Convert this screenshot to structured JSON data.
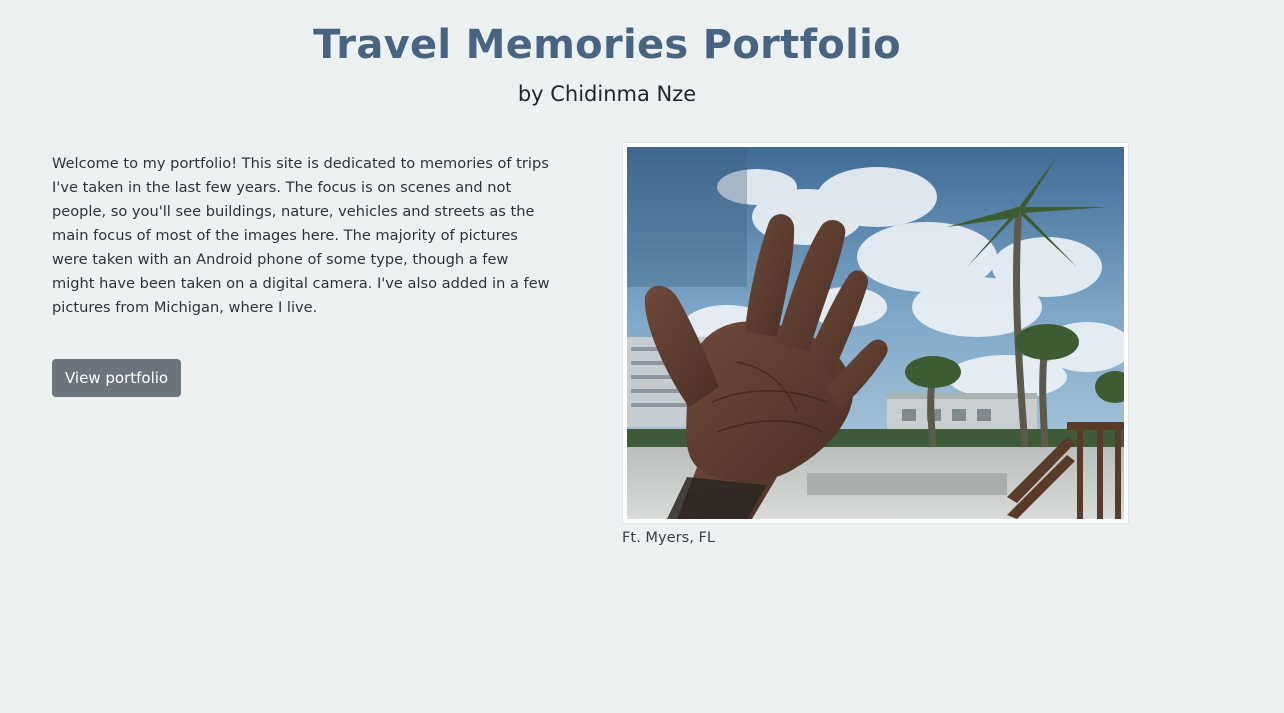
{
  "header": {
    "title": "Travel Memories Portfolio",
    "subtitle": "by Chidinma Nze"
  },
  "intro": {
    "text": "Welcome to my portfolio! This site is dedicated to memories of trips I've taken in the last few years. The focus is on scenes and not people, so you'll see buildings, nature, vehicles and streets as the main focus of most of the images here. The majority of pictures were taken with an Android phone of some type, though a few might have been taken on a digital camera. I've also added in a few pictures from Michigan, where I live."
  },
  "actions": {
    "view_portfolio_label": "View portfolio"
  },
  "featured_photo": {
    "caption": "Ft. Myers, FL"
  },
  "colors": {
    "background": "#ecf0f1",
    "title": "#476482",
    "button": "#6c757d",
    "button_text": "#ffffff"
  }
}
